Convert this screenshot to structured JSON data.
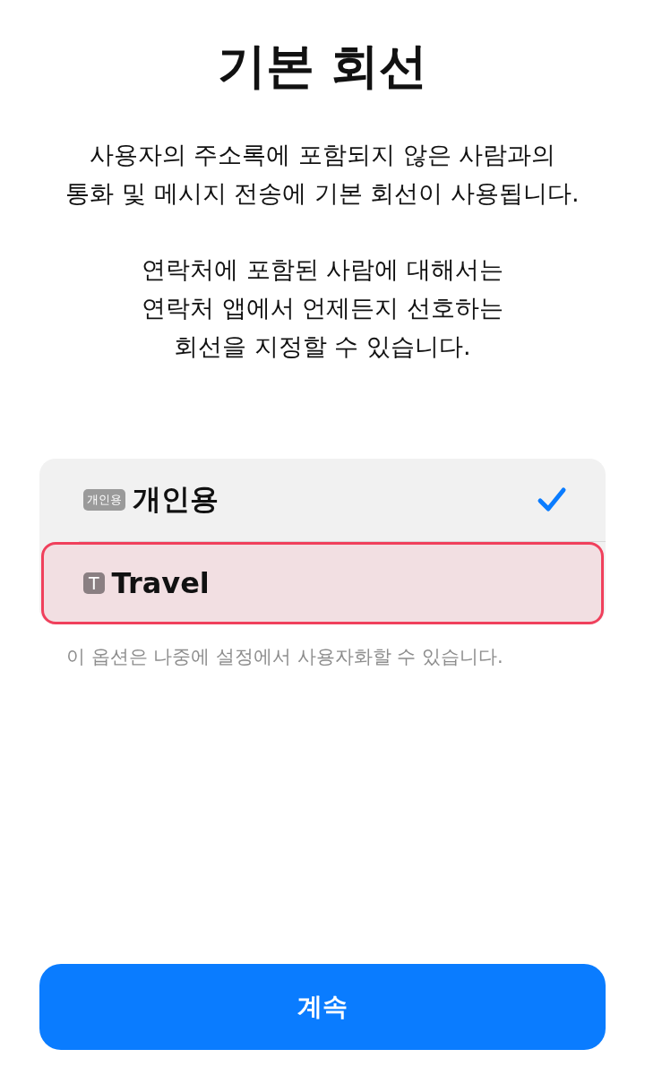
{
  "title": "기본 회선",
  "paragraphs": [
    "사용자의 주소록에 포함되지 않은 사람과의\n통화 및 메시지 전송에 기본 회선이 사용됩니다.",
    "연락처에 포함된 사람에 대해서는\n연락처 앱에서 언제든지 선호하는\n회선을 지정할 수 있습니다."
  ],
  "lines": [
    {
      "badge": "개인용",
      "label": "개인용",
      "selected": true,
      "highlighted": false
    },
    {
      "badge": "T",
      "label": "Travel",
      "selected": false,
      "highlighted": true
    }
  ],
  "footnote": "이 옵션은 나중에 설정에서 사용자화할 수 있습니다.",
  "continue_button": "계속"
}
